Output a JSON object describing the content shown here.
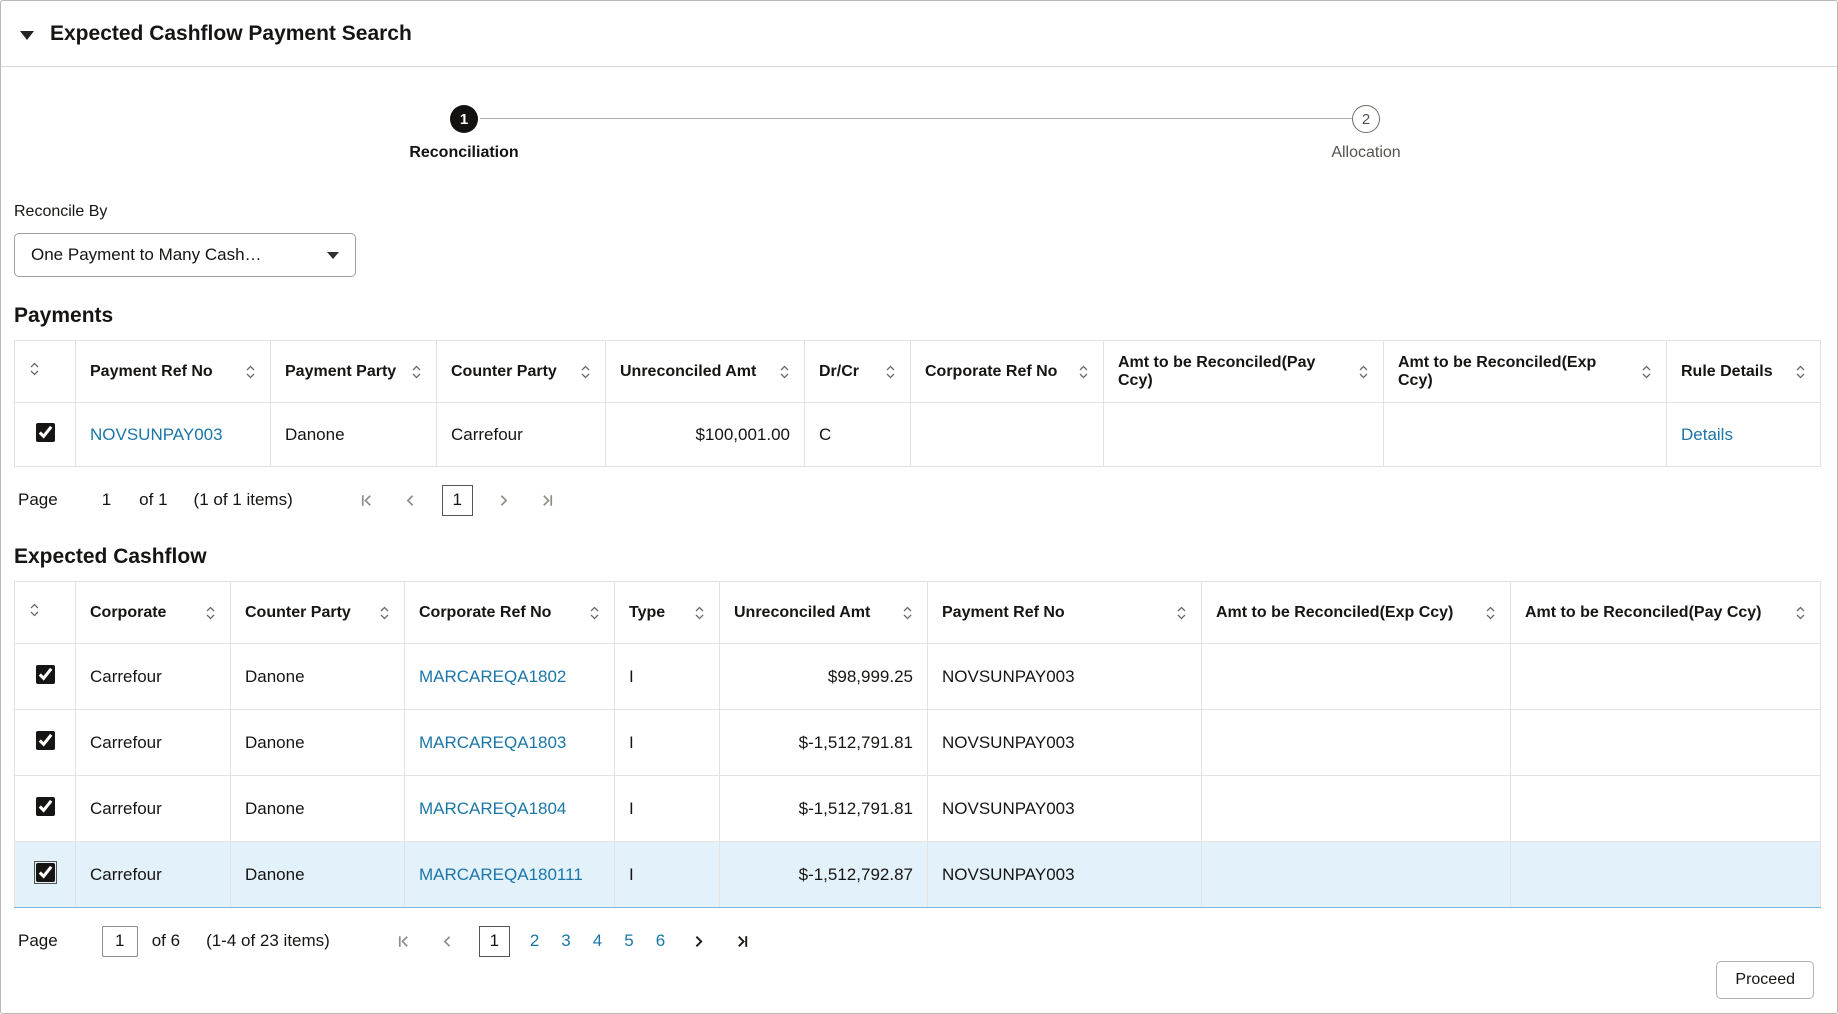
{
  "page": {
    "title": "Expected Cashflow Payment Search"
  },
  "icons": {
    "collapse": "▼",
    "dropdown_arrow": "▼",
    "sort": "⇅",
    "first_page": "|<",
    "prev_page": "<",
    "next_page": ">",
    "last_page": ">|"
  },
  "stepper": {
    "steps": [
      {
        "number": "1",
        "label": "Reconciliation",
        "state": "active"
      },
      {
        "number": "2",
        "label": "Allocation",
        "state": "inactive"
      }
    ]
  },
  "reconcile_by": {
    "label": "Reconcile By",
    "value": "One Payment to Many Cash…"
  },
  "payments": {
    "title": "Payments",
    "headers": [
      "Payment Ref No",
      "Payment Party",
      "Counter Party",
      "Unreconciled Amt",
      "Dr/Cr",
      "Corporate Ref No",
      "Amt to be Reconciled(Pay Ccy)",
      "Amt to be Reconciled(Exp Ccy)",
      "Rule Details"
    ],
    "row": {
      "selected": true,
      "payment_ref_no": "NOVSUNPAY003",
      "payment_party": "Danone",
      "counter_party": "Carrefour",
      "unreconciled_amt": "$100,001.00",
      "dr_cr": "C",
      "corporate_ref_no": "",
      "amt_pay_ccy": "",
      "amt_exp_ccy": "",
      "rule_details": "Details"
    },
    "pagination": {
      "page_label": "Page",
      "page_value": "1",
      "of_text": "of 1",
      "items_text": "(1 of 1 items)",
      "current_page": "1"
    }
  },
  "expected_cashflow": {
    "title": "Expected Cashflow",
    "headers": [
      "Corporate",
      "Counter Party",
      "Corporate Ref No",
      "Type",
      "Unreconciled Amt",
      "Payment Ref No",
      "Amt to be Reconciled(Exp Ccy)",
      "Amt to be Reconciled(Pay Ccy)"
    ],
    "rows": [
      {
        "selected": true,
        "corporate": "Carrefour",
        "counter_party": "Danone",
        "corporate_ref_no": "MARCAREQA1802",
        "type": "I",
        "unreconciled_amt": "$98,999.25",
        "payment_ref_no": "NOVSUNPAY003",
        "amt_exp_ccy": "",
        "amt_pay_ccy": "",
        "highlighted": false
      },
      {
        "selected": true,
        "corporate": "Carrefour",
        "counter_party": "Danone",
        "corporate_ref_no": "MARCAREQA1803",
        "type": "I",
        "unreconciled_amt": "$-1,512,791.81",
        "payment_ref_no": "NOVSUNPAY003",
        "amt_exp_ccy": "",
        "amt_pay_ccy": "",
        "highlighted": false
      },
      {
        "selected": true,
        "corporate": "Carrefour",
        "counter_party": "Danone",
        "corporate_ref_no": "MARCAREQA1804",
        "type": "I",
        "unreconciled_amt": "$-1,512,791.81",
        "payment_ref_no": "NOVSUNPAY003",
        "amt_exp_ccy": "",
        "amt_pay_ccy": "",
        "highlighted": false
      },
      {
        "selected": true,
        "corporate": "Carrefour",
        "counter_party": "Danone",
        "corporate_ref_no": "MARCAREQA180111",
        "type": "I",
        "unreconciled_amt": "$-1,512,792.87",
        "payment_ref_no": "NOVSUNPAY003",
        "amt_exp_ccy": "",
        "amt_pay_ccy": "",
        "highlighted": true
      }
    ],
    "pagination": {
      "page_label": "Page",
      "page_value": "1",
      "of_text": "of 6",
      "items_text": "(1-4 of 23 items)",
      "current_page": "1",
      "pages": [
        "2",
        "3",
        "4",
        "5",
        "6"
      ]
    }
  },
  "footer": {
    "proceed_label": "Proceed"
  }
}
